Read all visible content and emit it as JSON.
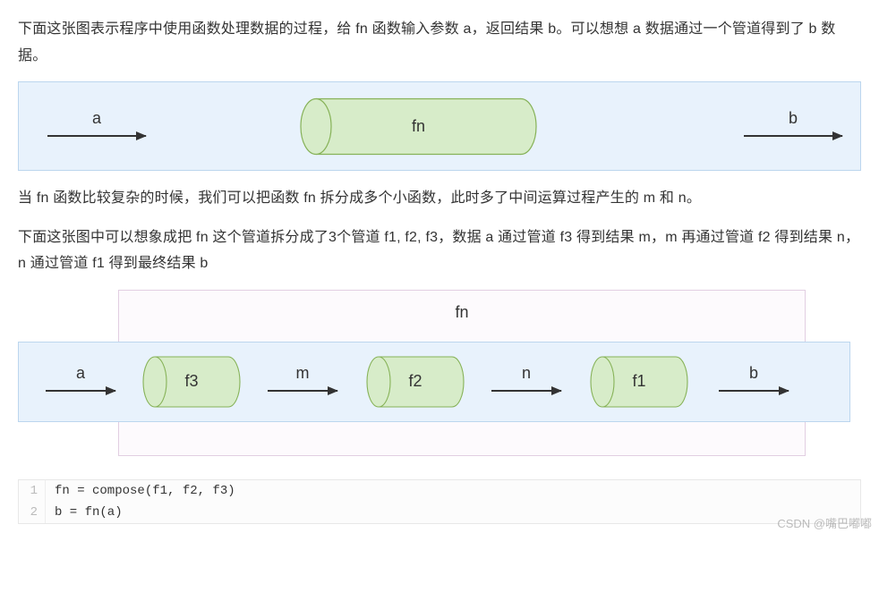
{
  "para1": "下面这张图表示程序中使用函数处理数据的过程，给 fn 函数输入参数 a，返回结果 b。可以想想 a 数据通过一个管道得到了 b 数据。",
  "para2": "当 fn 函数比较复杂的时候，我们可以把函数 fn 拆分成多个小函数，此时多了中间运算过程产生的 m 和 n。",
  "para3": "下面这张图中可以想象成把 fn 这个管道拆分成了3个管道 f1, f2, f3，数据 a 通过管道 f3 得到结果 m，m 再通过管道 f2 得到结果 n，n 通过管道 f1 得到最终结果 b",
  "diagram1": {
    "input": "a",
    "pipe": "fn",
    "output": "b"
  },
  "diagram2": {
    "outer_label": "fn",
    "input": "a",
    "pipes": [
      "f3",
      "f2",
      "f1"
    ],
    "intermediates": [
      "m",
      "n"
    ],
    "output": "b"
  },
  "code": {
    "lines": [
      "fn = compose(f1, f2, f3)",
      "b = fn(a)"
    ]
  },
  "watermark": "CSDN @嘴巴嘟嘟"
}
